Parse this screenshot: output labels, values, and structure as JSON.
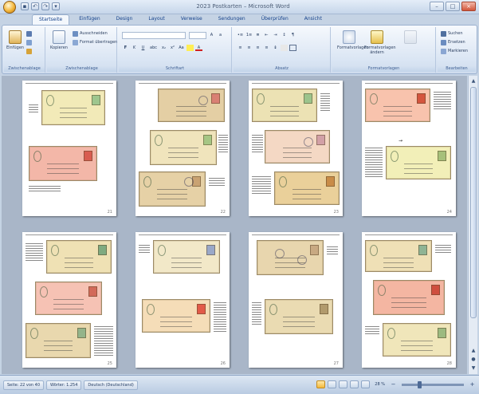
{
  "window": {
    "title": "2023 Postkarten – Microsoft Word"
  },
  "tabs": [
    {
      "label": "Startseite",
      "active": true
    },
    {
      "label": "Einfügen",
      "active": false
    },
    {
      "label": "Design",
      "active": false
    },
    {
      "label": "Layout",
      "active": false
    },
    {
      "label": "Verweise",
      "active": false
    },
    {
      "label": "Sendungen",
      "active": false
    },
    {
      "label": "Überprüfen",
      "active": false
    },
    {
      "label": "Ansicht",
      "active": false
    }
  ],
  "ribbon": {
    "groups": {
      "clipboard": "Zwischenablage",
      "font": "Schriftart",
      "paragraph": "Absatz",
      "styles": "Formatvorlagen",
      "editing": "Bearbeiten"
    },
    "paste_label": "Einfügen",
    "copy_label": "Kopieren",
    "cut_label": "Ausschneiden",
    "format_painter_label": "Format übertragen",
    "font_buttons": [
      "F",
      "K",
      "U",
      "abc",
      "x₂",
      "x²",
      "Aa"
    ],
    "para_buttons": [
      "≡",
      "≡",
      "≡",
      "≡",
      "¶"
    ],
    "styles_label": "Formatvorlagen",
    "styles_change": "Formatvorlagen ändern",
    "find_label": "Suchen",
    "replace_label": "Ersetzen",
    "select_label": "Markieren"
  },
  "pages": {
    "numbers": [
      "21",
      "22",
      "23",
      "24",
      "25",
      "26",
      "27",
      "28"
    ]
  },
  "statusbar": {
    "buttons": [
      "Seite: 22 von 40",
      "Wörter: 1.254",
      "Deutsch (Deutschland)"
    ],
    "zoom": "28 %"
  },
  "colors": {
    "ribbon_bg": "#dbe6f4",
    "doc_bg": "#a9b6c8",
    "card_beige": "#ead8b4",
    "card_pink": "#f3b7a8",
    "card_yellow": "#f2eab8"
  }
}
